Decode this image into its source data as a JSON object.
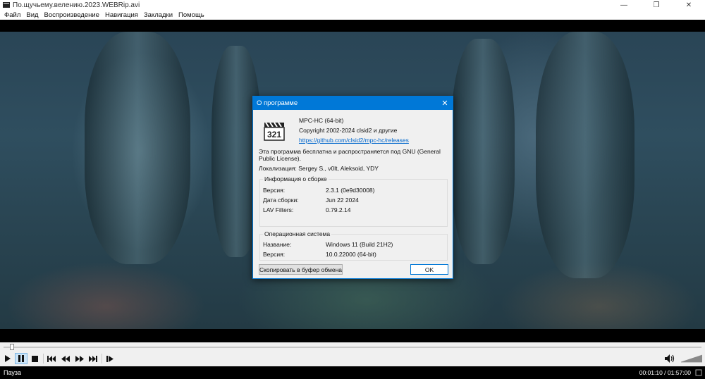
{
  "window": {
    "title": "По.щучьему.велению.2023.WEBRip.avi",
    "minimize": "—",
    "maximize": "❐",
    "close": "✕"
  },
  "menu": [
    "Файл",
    "Вид",
    "Воспроизведение",
    "Навигация",
    "Закладки",
    "Помощь"
  ],
  "dialog": {
    "title": "О программе",
    "close": "✕",
    "product": "MPC-HC (64-bit)",
    "copyright": "Copyright 2002-2024 clsid2 и другие",
    "link": "https://github.com/clsid2/mpc-hc/releases",
    "license": "Эта программа бесплатна и распространяется под GNU (General Public License).",
    "localization": "Локализация: Sergey S., v0lt, Aleksoid, YDY",
    "build_group": {
      "title": "Информация о сборке",
      "rows": [
        {
          "label": "Версия:",
          "value": "2.3.1 (0e9d30008)"
        },
        {
          "label": "Дата сборки:",
          "value": "Jun 22 2024"
        },
        {
          "label": "LAV Filters:",
          "value": "0.79.2.14"
        }
      ]
    },
    "os_group": {
      "title": "Операционная система",
      "rows": [
        {
          "label": "Название:",
          "value": "Windows 11 (Build 21H2)"
        },
        {
          "label": "Версия:",
          "value": "10.0.22000 (64-bit)"
        }
      ]
    },
    "copy_button": "Скопировать в буфер обмена",
    "ok_button": "OK"
  },
  "player": {
    "seek_position": 0.0123,
    "volume_level": 1.0,
    "icons": [
      "play-icon",
      "pause-icon",
      "stop-icon",
      "skip-back-icon",
      "rewind-icon",
      "fast-forward-icon",
      "skip-forward-icon",
      "frame-step-icon",
      "volume-icon"
    ]
  },
  "status": {
    "state": "Пауза",
    "time": "00:01:10 / 01:57:00"
  },
  "colors": {
    "accent": "#0078d7",
    "link": "#0066cc"
  }
}
